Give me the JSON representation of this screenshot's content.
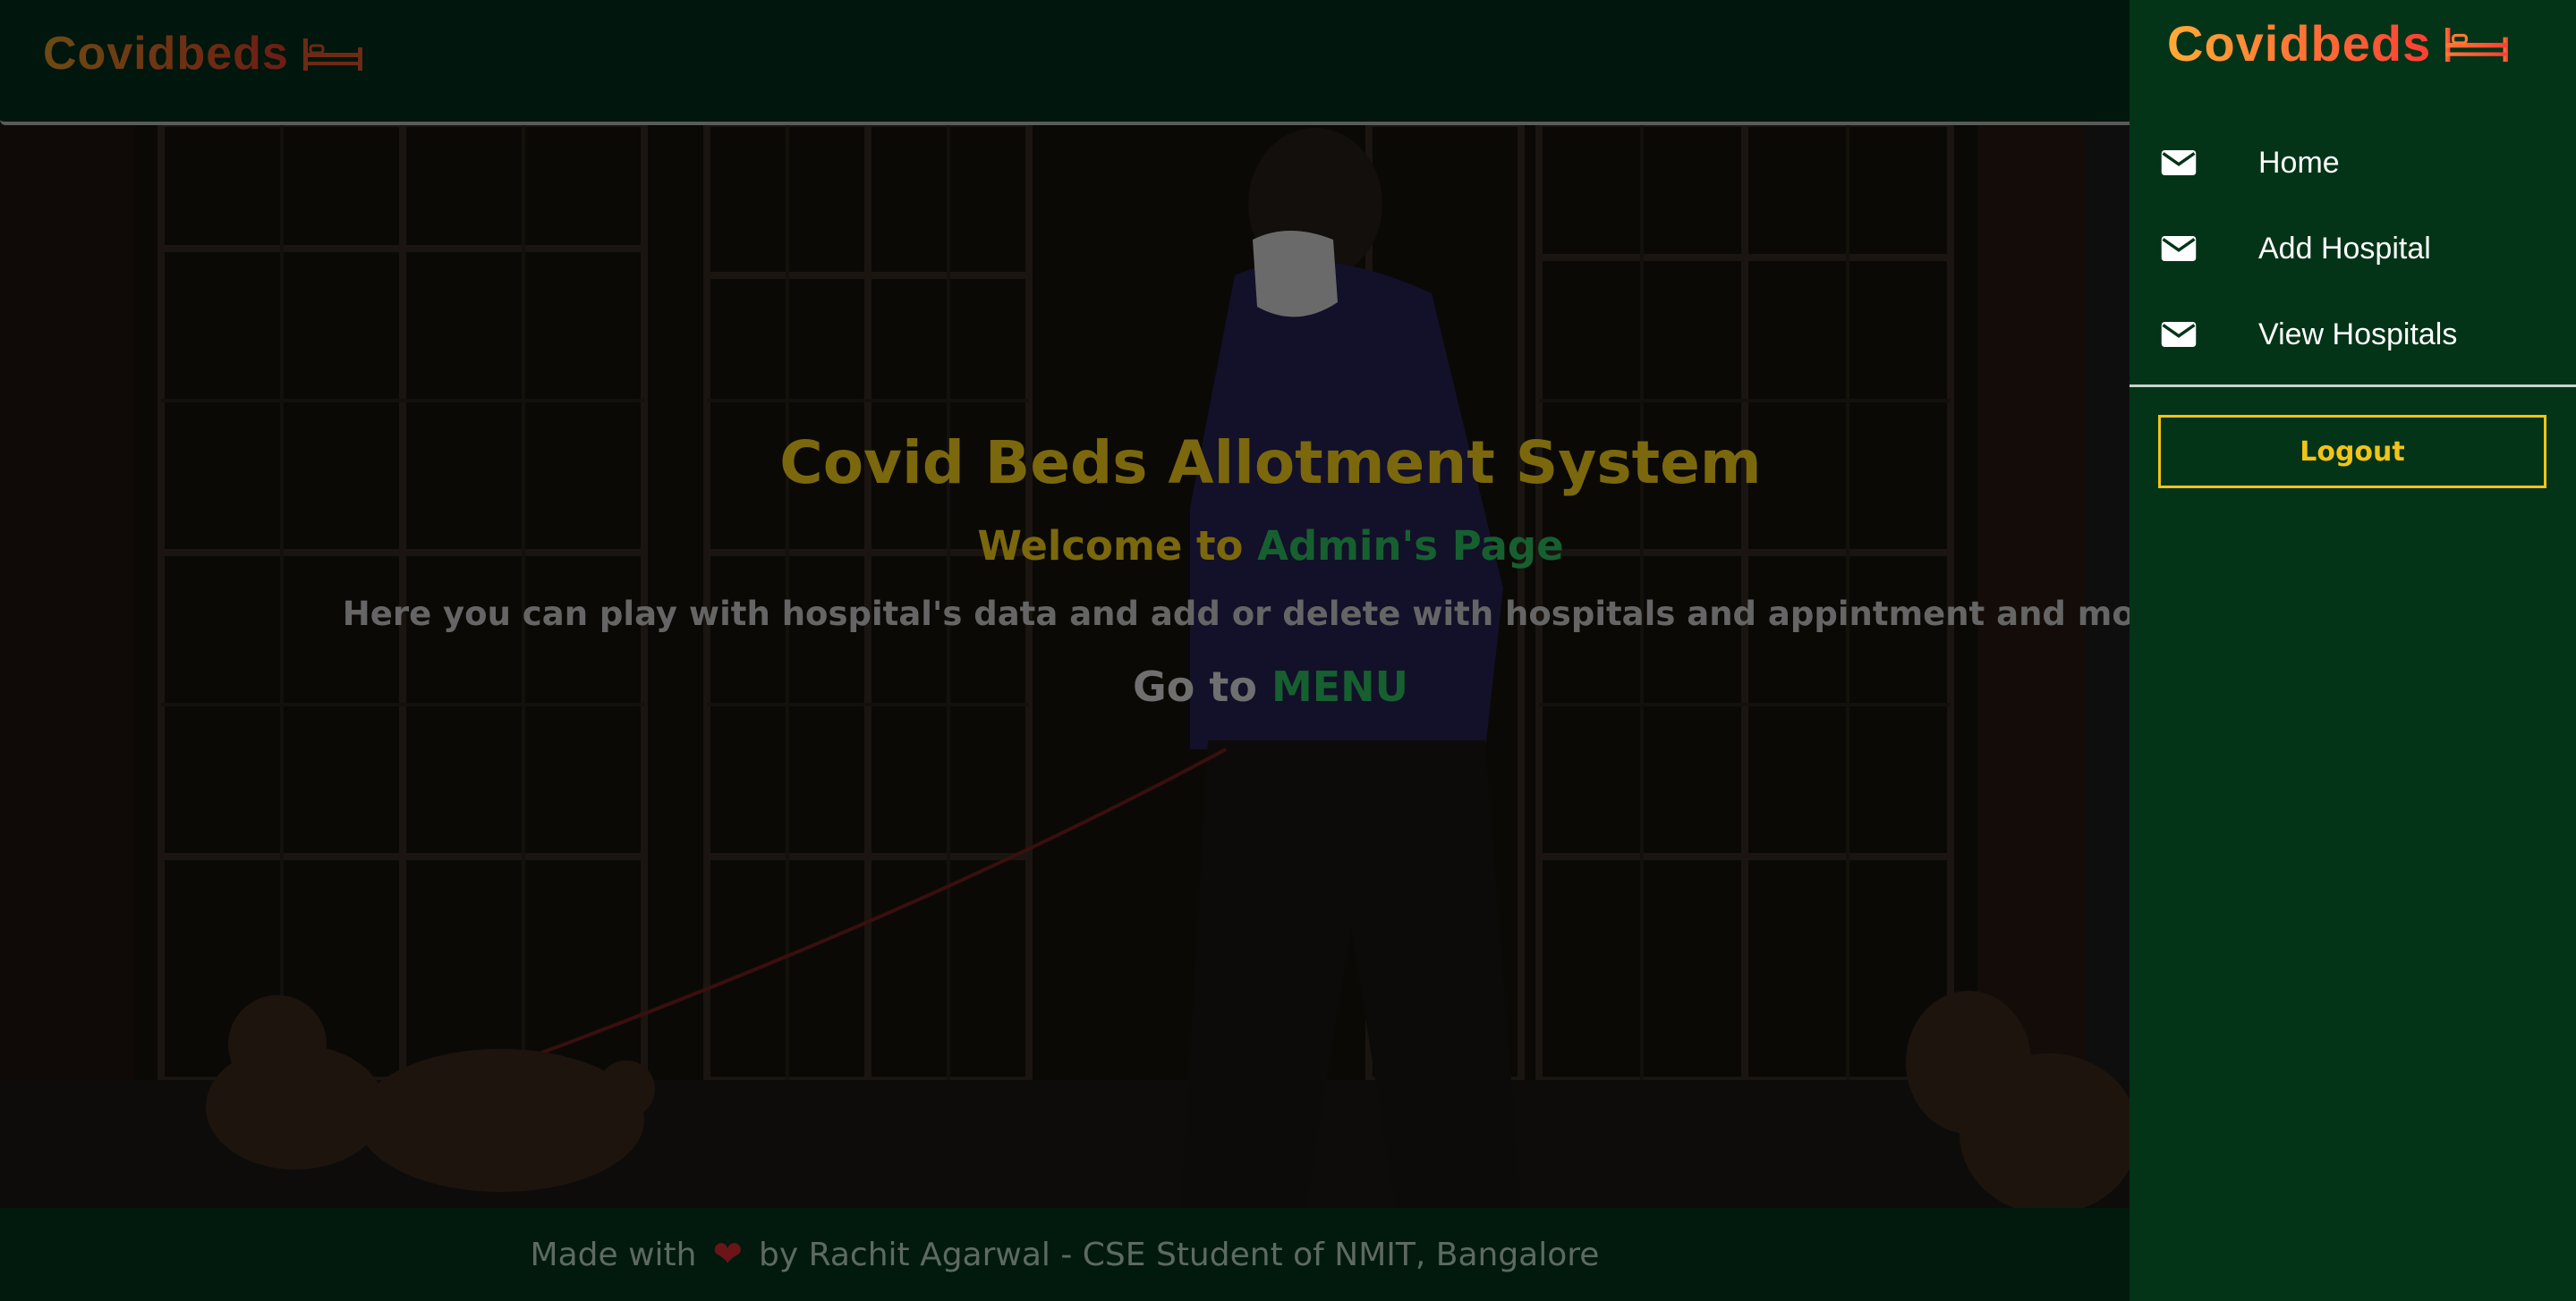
{
  "brand": {
    "name": "Covidbeds",
    "icon": "bed-icon"
  },
  "hero": {
    "title": "Covid Beds Allotment System",
    "welcome_prefix": "Welcome to",
    "welcome_accent": "Admin's Page",
    "description": "Here you can play with hospital's data and add or delete with hospitals and appintment and more..",
    "goto_prefix": "Go to",
    "goto_link": "MENU"
  },
  "footer": {
    "made_with": "Made with",
    "heart_icon": "heart-icon",
    "credit": "by Rachit Agarwal - CSE Student of NMIT, Bangalore"
  },
  "sidebar": {
    "items": [
      {
        "label": "Home",
        "icon": "mail-icon"
      },
      {
        "label": "Add Hospital",
        "icon": "mail-icon"
      },
      {
        "label": "View Hospitals",
        "icon": "mail-icon"
      }
    ],
    "logout_label": "Logout"
  },
  "colors": {
    "sidebar_bg": "#033417",
    "topbar_bg": "#01160c",
    "title_gold": "#7b680d",
    "accent_green": "#16602f",
    "logout_yellow": "#f0c419",
    "brand_gradient_start": "#ffac38",
    "brand_gradient_end": "#ff3d34"
  }
}
